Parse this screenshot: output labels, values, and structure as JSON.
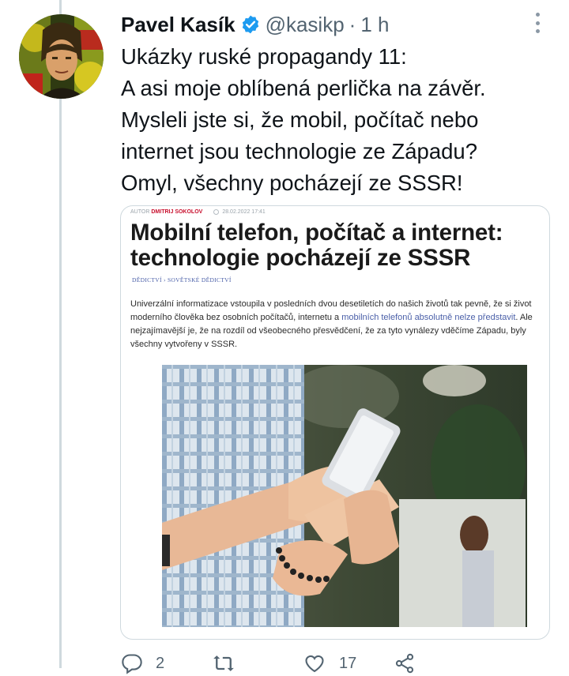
{
  "tweet": {
    "author_name": "Pavel Kasík",
    "handle": "@kasikp",
    "separator": "·",
    "time": "1 h",
    "text_lines": [
      "Ukázky ruské propagandy 11:",
      "A asi moje oblíbená perlička na závěr.",
      "Mysleli jste si, že mobil, počítač nebo",
      "internet jsou technologie ze Západu?",
      "Omyl, všechny pocházejí ze SSSR!"
    ]
  },
  "card": {
    "author_label": "AUTOR",
    "author": "DMITRIJ SOKOLOV",
    "date": "28.02.2022 17:41",
    "headline_line1": "Mobilní telefon, počítač a internet:",
    "headline_line2": "technologie pocházejí ze SSSR",
    "breadcrumb": "DĚDICTVÍ › SOVĚTSKÉ DĚDICTVÍ",
    "lead_part1": "Univerzální informatizace vstoupila v posledních dvou desetiletích do našich životů tak pevně, že si život moderního člověka bez osobních počítačů, internetu a ",
    "lead_link": "mobilních telefonů absolutně nelze představit",
    "lead_part2": ". Ale nejzajímavější je, že na rozdíl od všeobecného přesvědčení, že za tyto vynálezy vděčíme Západu, byly všechny vytvořeny v SSSR."
  },
  "actions": {
    "replies": "2",
    "retweets": "",
    "likes": "17"
  },
  "colors": {
    "verified": "#1d9bf0",
    "author_red": "#c8102e",
    "link_blue": "#4a5fa8",
    "muted": "#536471"
  }
}
